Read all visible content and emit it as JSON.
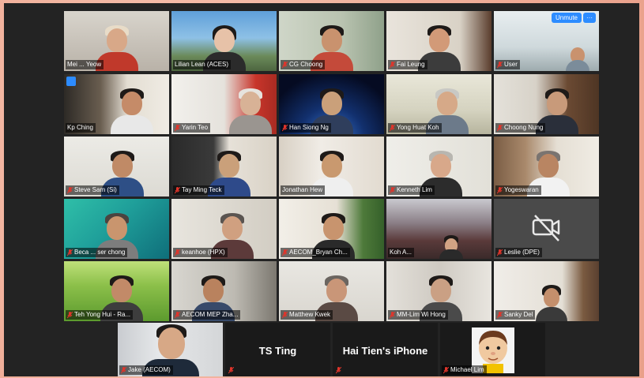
{
  "participants": [
    {
      "name": "Mei ... Yeow",
      "muted": false,
      "active_speaker": true
    },
    {
      "name": "Lilian Lean (ACES)",
      "muted": false
    },
    {
      "name": "CG Choong",
      "muted": true
    },
    {
      "name": "Fai Leung",
      "muted": true
    },
    {
      "name": "User",
      "muted": true
    },
    {
      "name": "Kp Ching",
      "muted": false,
      "hand_raised": true
    },
    {
      "name": "Yarin Teo",
      "muted": true
    },
    {
      "name": "Han Siong Ng",
      "muted": true
    },
    {
      "name": "Yong Huat Koh",
      "muted": true
    },
    {
      "name": "Choong Nung",
      "muted": true
    },
    {
      "name": "Steve Sam (Si)",
      "muted": true
    },
    {
      "name": "Tay Ming Teck",
      "muted": true
    },
    {
      "name": "Jonathan Hew",
      "muted": false
    },
    {
      "name": "Kenneth Lim",
      "muted": true
    },
    {
      "name": "Yogeswaran",
      "muted": true
    },
    {
      "name": "Beca ... ser chong",
      "muted": true
    },
    {
      "name": "keanhoe (HPX)",
      "muted": true
    },
    {
      "name": "AECOM_Bryan Ch...",
      "muted": true
    },
    {
      "name": "Koh A...",
      "muted": false
    },
    {
      "name": "Leslie (DPE)",
      "muted": true
    },
    {
      "name": "Teh Yong Hui - Ra...",
      "muted": true
    },
    {
      "name": "AECOM MEP Zha...",
      "muted": true
    },
    {
      "name": "Matthew Kwek",
      "muted": true
    },
    {
      "name": "MM-Lim Wi Hong",
      "muted": true
    },
    {
      "name": "Sanky Del",
      "muted": true
    },
    {
      "name": "Jake (AECOM)",
      "muted": true
    },
    {
      "name": "TS Ting",
      "muted": true
    },
    {
      "name": "Hai Tien's iPhone",
      "muted": true
    },
    {
      "name": "Michael Lim",
      "muted": true
    }
  ],
  "controls": {
    "unmute_label": "Unmute",
    "more_label": "···"
  },
  "colors": {
    "active_outline": "#b6e24a",
    "zoom_blue": "#2d8cff",
    "mic_muted": "#e0352b"
  }
}
